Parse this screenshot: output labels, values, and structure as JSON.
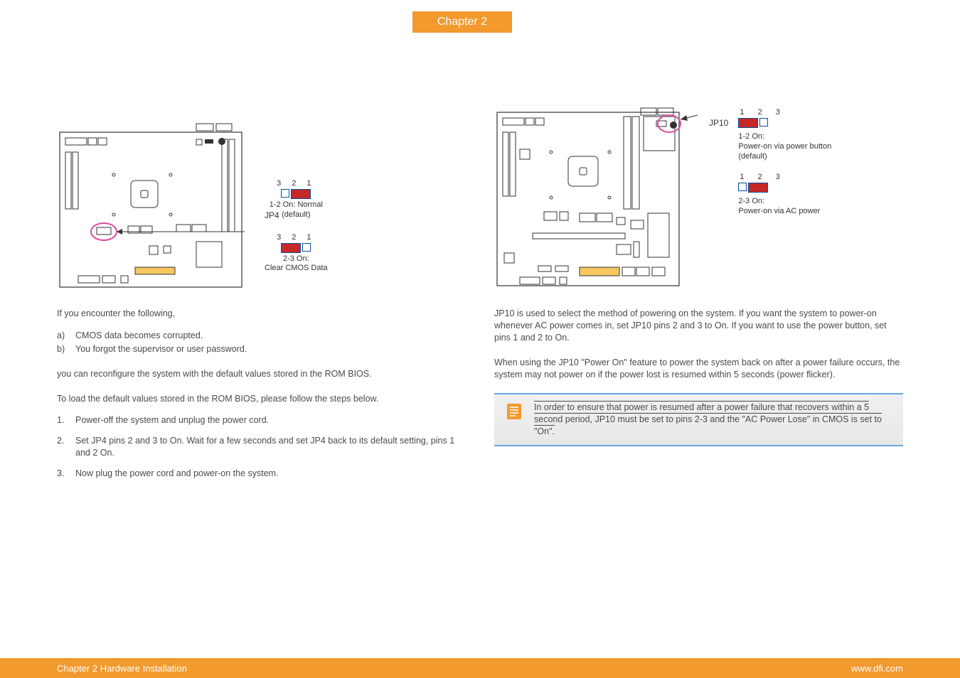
{
  "chapter_tab": "Chapter 2",
  "left": {
    "jp_label": "JP4",
    "jumper1": {
      "pins": "3  2  1",
      "desc_line1": "1-2 On: Normal",
      "desc_line2": "(default)"
    },
    "jumper2": {
      "pins": "3  2  1",
      "desc_line1": "2-3 On:",
      "desc_line2": "Clear CMOS Data"
    },
    "intro": "If you encounter the following,",
    "list_a_label": "a)",
    "list_a_text": "CMOS data becomes corrupted.",
    "list_b_label": "b)",
    "list_b_text": "You forgot the supervisor or user password.",
    "para2": "you can reconfigure the system with the default values stored in the ROM BIOS.",
    "para3": "To load the default values stored in the ROM BIOS, please follow the steps below.",
    "step1_label": "1.",
    "step1_text": "Power-off the system and unplug the power cord.",
    "step2_label": "2.",
    "step2_text": "Set JP4 pins 2 and 3 to On. Wait for a few seconds and set JP4 back to its default setting, pins 1 and 2 On.",
    "step3_label": "3.",
    "step3_text": "Now plug the power cord and power-on the system."
  },
  "right": {
    "jp_label": "JP10",
    "jumper1": {
      "pins": "1  2  3",
      "desc_line1": "1-2 On:",
      "desc_line2": "Power-on via power button",
      "desc_line3": "(default)"
    },
    "jumper2": {
      "pins": "1  2  3",
      "desc_line1": "2-3 On:",
      "desc_line2": "Power-on via AC power"
    },
    "para1": "JP10 is used to select the method of powering on the system. If you want the system to power-on whenever AC power comes in, set JP10 pins 2 and 3 to On. If you want to use the power button, set pins 1 and 2 to On.",
    "para2": "When using the JP10 \"Power On\" feature to power the system back on after a power failure occurs, the system may not power on if the power lost is resumed within 5 seconds (power flicker).",
    "note": "In order to ensure that power is resumed after a power failure that recovers within a 5 second period, JP10 must be set to pins 2-3 and the \"AC Power Lose\" in CMOS is set to \"On\"."
  },
  "footer": {
    "left": "Chapter 2 Hardware Installation",
    "right": "www.dfi.com"
  }
}
